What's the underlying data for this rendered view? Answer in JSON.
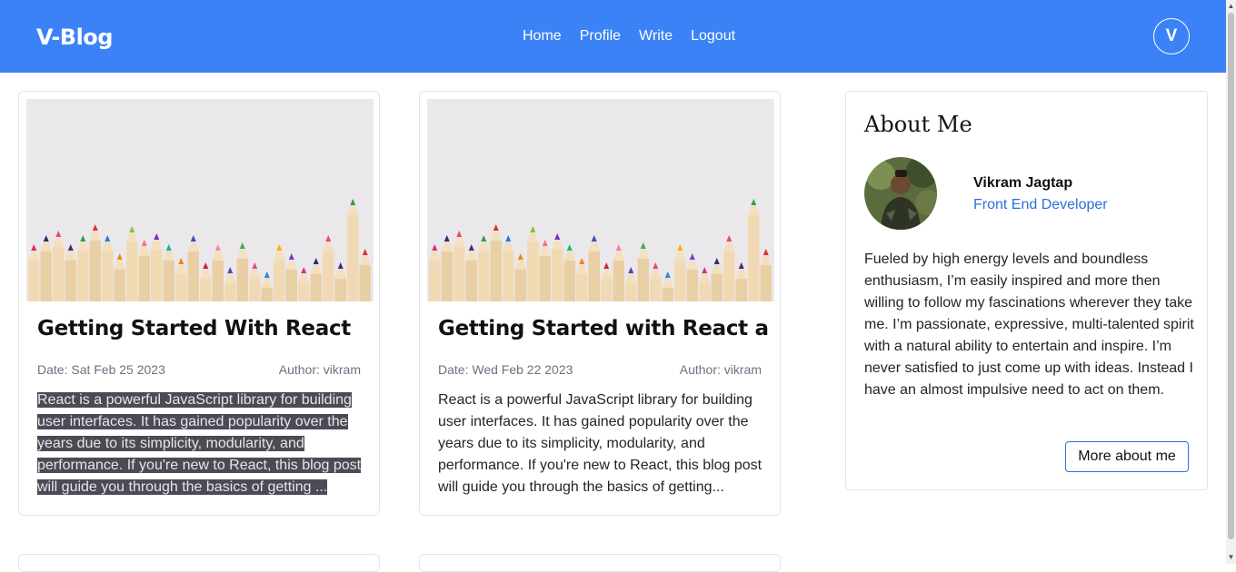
{
  "navbar": {
    "brand": "V-Blog",
    "links": [
      "Home",
      "Profile",
      "Write",
      "Logout"
    ],
    "avatar_letter": "V"
  },
  "posts": [
    {
      "title": "Getting Started With React",
      "date": "Date: Sat Feb 25 2023",
      "author": "Author: vikram",
      "excerpt": "React is a powerful JavaScript library for building user interfaces. It has gained popularity over the years due to its simplicity, modularity, and performance. If you're new to React, this blog post will guide you through the basics of getting ...",
      "image_icon": "colored-pencils-image",
      "selected": true
    },
    {
      "title": "Getting Started with React a",
      "date": "Date: Wed Feb 22 2023",
      "author": "Author: vikram",
      "excerpt": "React is a powerful JavaScript library for building user interfaces. It has gained popularity over the years due to its simplicity, modularity, and performance. If you're new to React, this blog post will guide you through the basics of getting...",
      "image_icon": "colored-pencils-image",
      "selected": false
    }
  ],
  "about": {
    "heading": "About Me",
    "name": "Vikram Jagtap",
    "role": "Front End Developer",
    "bio": "Fueled by high energy levels and boundless enthusiasm, I’m easily inspired and more then willing to follow my fascinations wherever they take me. I’m passionate, expressive, multi-talented spirit with a natural ability to entertain and inspire. I’m never satisfied to just come up with ideas. Instead I have an almost impulsive need to act on them.",
    "button_label": "More about me"
  },
  "colors": {
    "navbar": "#3b82f6",
    "link_accent": "#2f6fd8",
    "selection": "#4a4b55"
  }
}
